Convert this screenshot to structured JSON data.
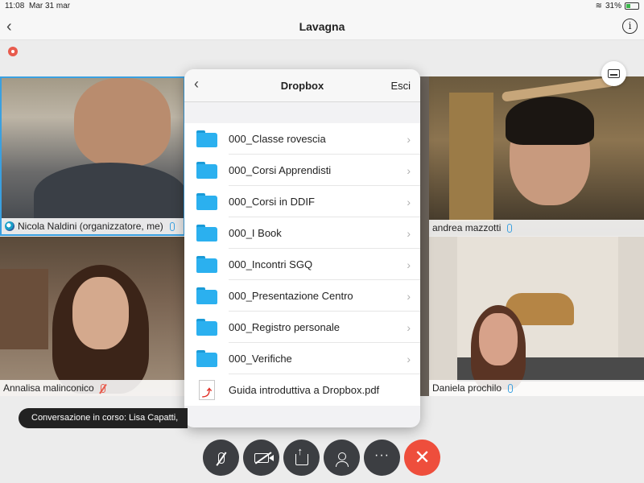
{
  "status_bar": {
    "time": "11:08",
    "date": "Mar 31 mar",
    "battery": "31%"
  },
  "nav": {
    "title": "Lavagna"
  },
  "participants": [
    {
      "name": "Nicola Naldini (organizzatore, me)",
      "muted": false
    },
    {
      "name": "andrea mazzotti",
      "muted": false
    },
    {
      "name": "Annalisa malinconico",
      "muted": true
    },
    {
      "name": "Daniela prochilo",
      "muted": false
    }
  ],
  "dropbox": {
    "title": "Dropbox",
    "close_label": "Esci",
    "items": [
      {
        "label": "000_Classe rovescia",
        "type": "folder"
      },
      {
        "label": "000_Corsi Apprendisti",
        "type": "folder"
      },
      {
        "label": "000_Corsi in DDIF",
        "type": "folder"
      },
      {
        "label": "000_I Book",
        "type": "folder"
      },
      {
        "label": "000_Incontri SGQ",
        "type": "folder"
      },
      {
        "label": "000_Presentazione Centro",
        "type": "folder"
      },
      {
        "label": "000_Registro personale",
        "type": "folder"
      },
      {
        "label": "000_Verifiche",
        "type": "folder"
      },
      {
        "label": "Guida introduttiva a Dropbox.pdf",
        "type": "pdf"
      }
    ]
  },
  "toast": {
    "text": "Conversazione in corso: Lisa Capatti,"
  },
  "colors": {
    "accent": "#3aa0e0",
    "end_call": "#ee4e3c",
    "folder": "#2bb0ef",
    "control_bg": "#3c3e42"
  }
}
